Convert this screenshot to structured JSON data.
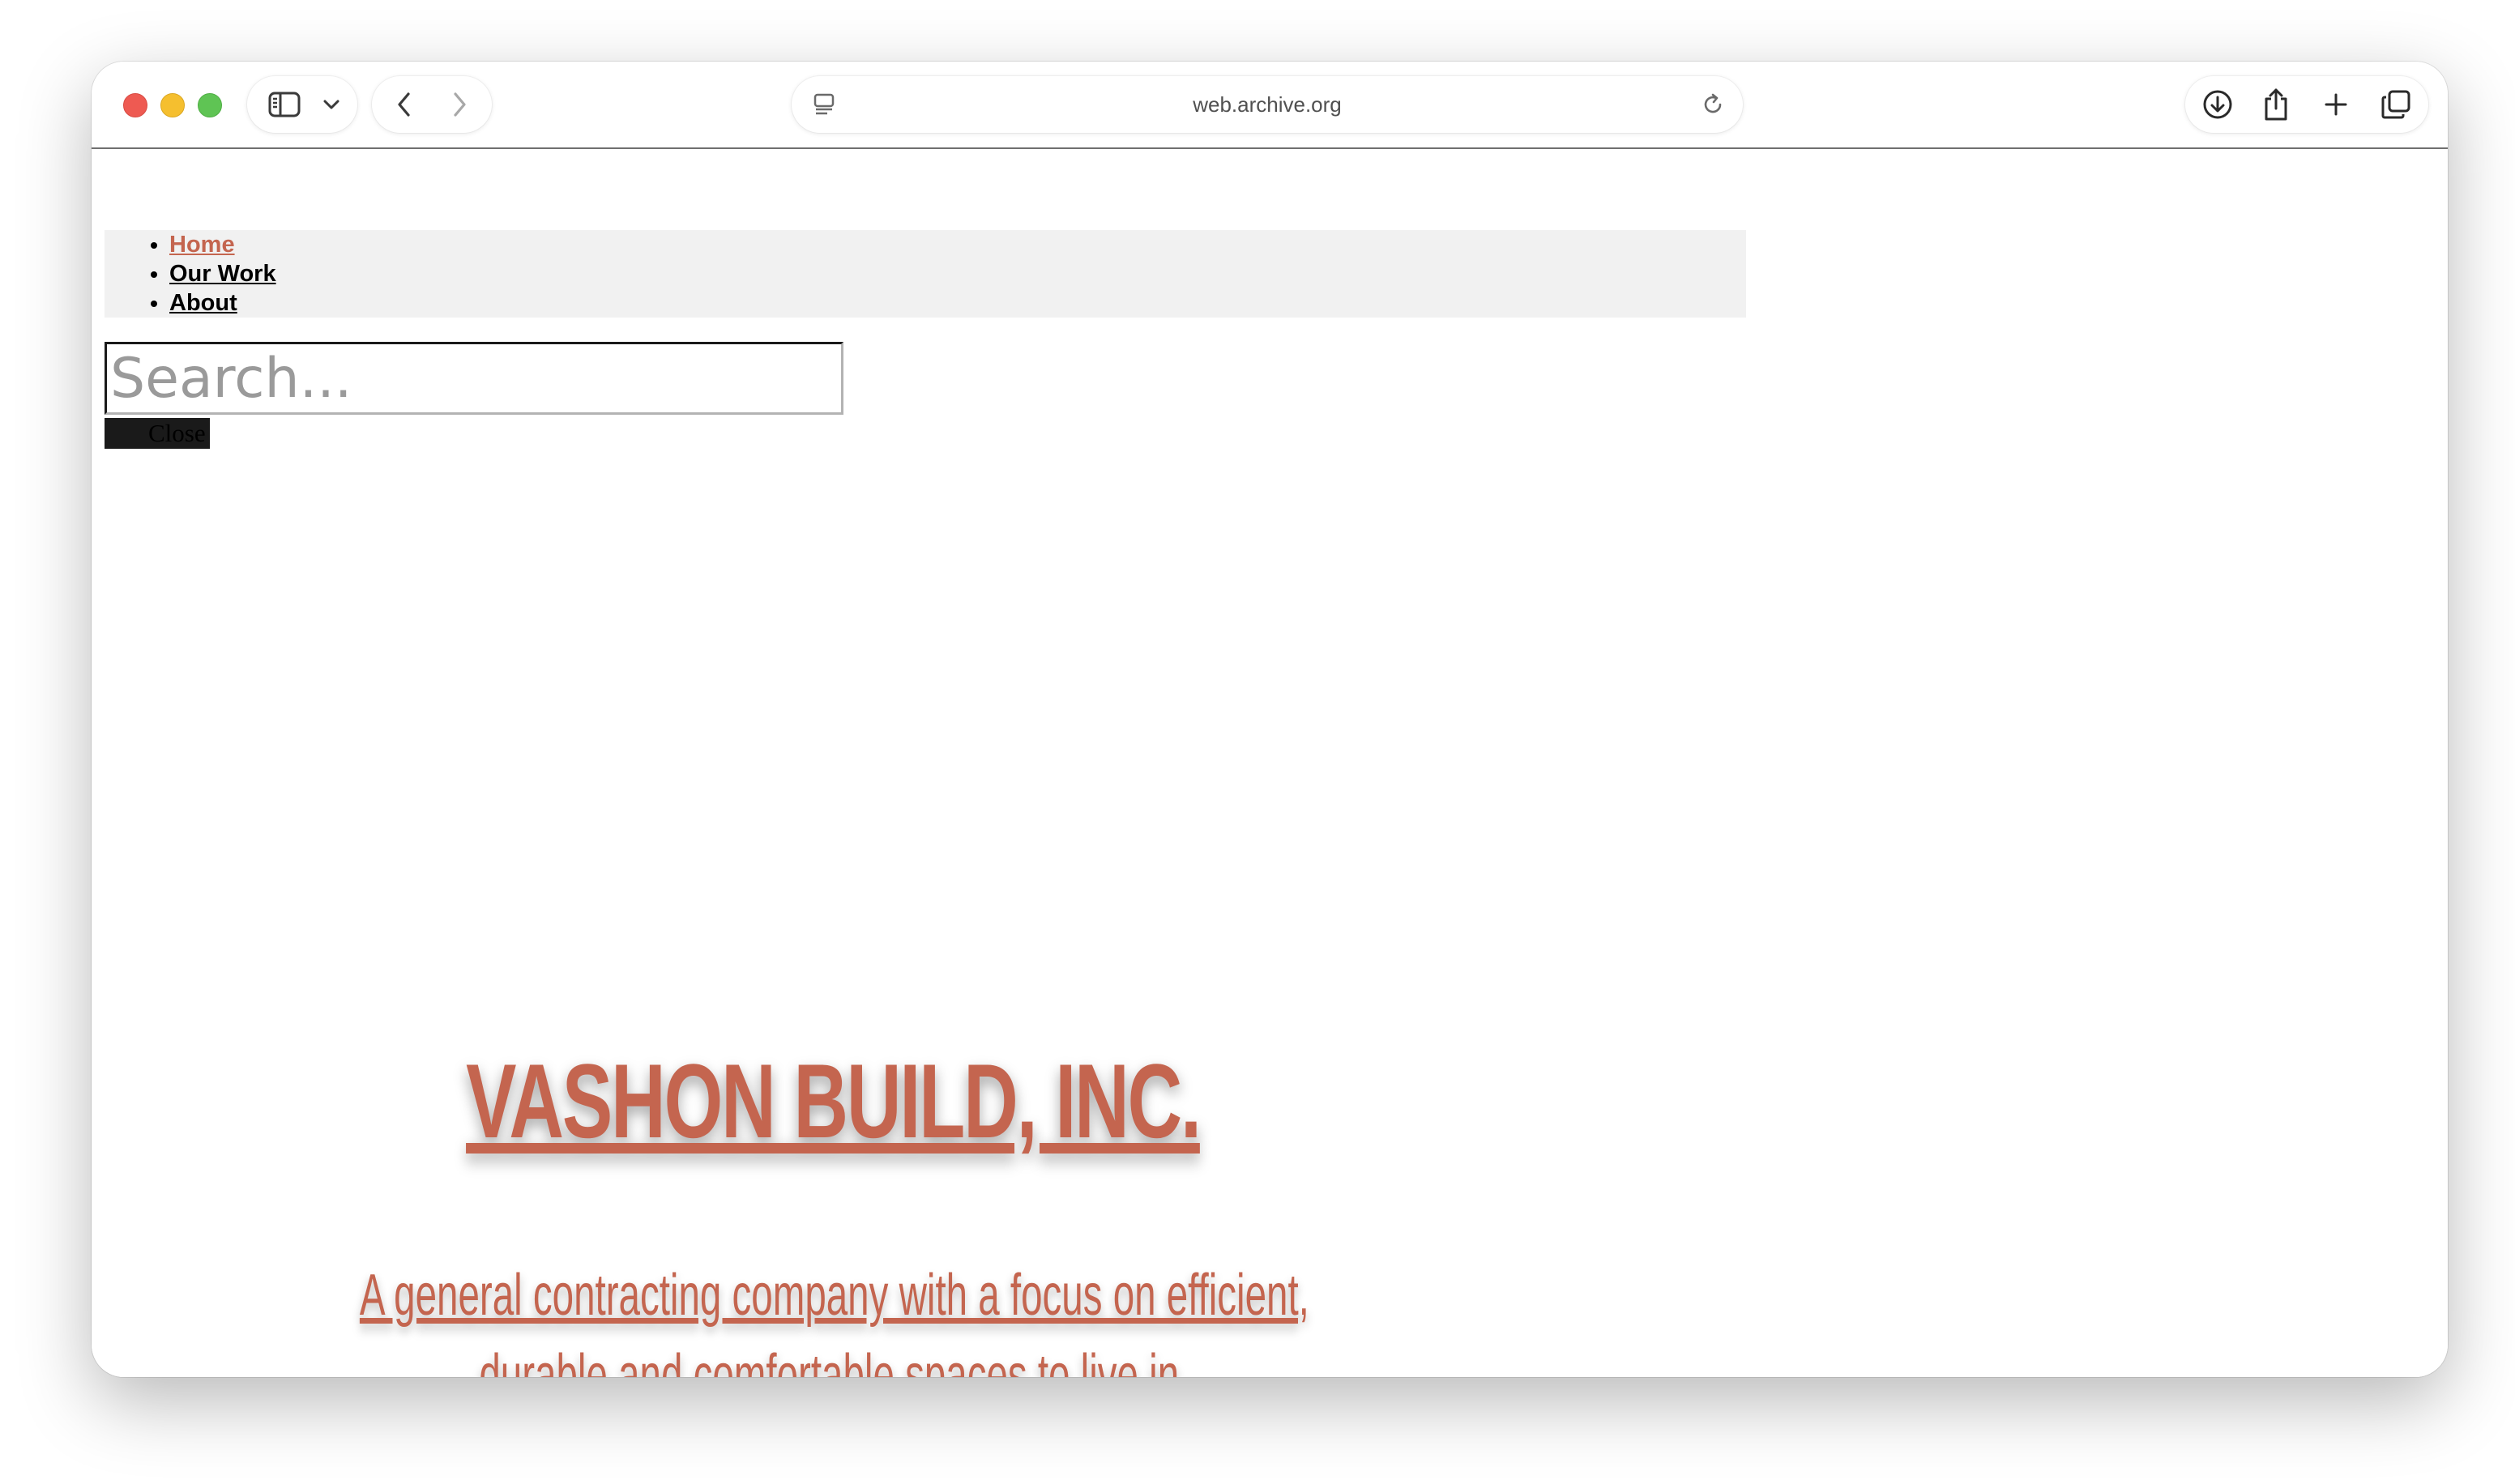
{
  "browser": {
    "url": "web.archive.org",
    "icons": {
      "sidebar": "sidebar-icon",
      "chevron": "chevron-down-icon",
      "back": "back-arrow-icon",
      "forward": "forward-arrow-icon",
      "reader": "reader-icon",
      "reload": "reload-icon",
      "download": "download-icon",
      "share": "share-icon",
      "new_tab": "plus-icon",
      "tabs": "tabs-overview-icon"
    }
  },
  "page": {
    "nav": {
      "items": [
        {
          "label": "Home",
          "active": true
        },
        {
          "label": "Our Work",
          "active": false
        },
        {
          "label": "About",
          "active": false
        }
      ]
    },
    "search": {
      "placeholder": "Search...",
      "value": ""
    },
    "close_label": "Close",
    "hero": {
      "title": "VASHON BUILD, INC.",
      "subtitle": "A general contracting company with a focus on efficient, durable and comfortable spaces to live in."
    },
    "colors": {
      "accent": "#c4654f",
      "nav_bg": "#f1f1f1",
      "close_bg": "#1a1a1a"
    }
  }
}
